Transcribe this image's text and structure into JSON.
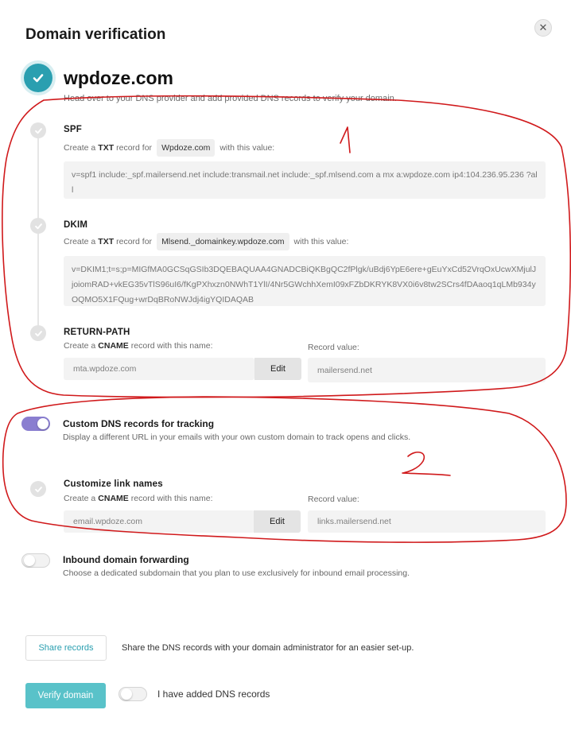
{
  "modal": {
    "title": "Domain verification",
    "close_symbol": "✕"
  },
  "domain": {
    "name": "wpdoze.com",
    "subtitle": "Head over to your DNS provider and add provided DNS records to verify your domain."
  },
  "records": {
    "spf": {
      "title": "SPF",
      "prefix": "Create a",
      "type": "TXT",
      "middle": "record for",
      "host": "Wpdoze.com",
      "suffix": "with this value:",
      "value": "v=spf1 include:_spf.mailersend.net include:transmail.net include:_spf.mlsend.com a mx a:wpdoze.com ip4:104.236.95.236 ?all"
    },
    "dkim": {
      "title": "DKIM",
      "prefix": "Create a",
      "type": "TXT",
      "middle": "record for",
      "host": "Mlsend._domainkey.wpdoze.com",
      "suffix": "with this value:",
      "value": "v=DKIM1;t=s;p=MIGfMA0GCSqGSIb3DQEBAQUAA4GNADCBiQKBgQC2fPlgk/uBdj6YpE6ere+gEuYxCd52VrqOxUcwXMjulJjoiomRAD+vkEG35vTlS96uI6/fKgPXhxzn0NWhT1YlI/4Nr5GWchhXemI09xFZbDKRYK8VX0i6v8tw2SCrs4fDAaoq1qLMb934yOQMO5X1FQug+wrDqBRoNWJdj4igYQIDAQAB"
    },
    "return_path": {
      "title": "RETURN-PATH",
      "prefix": "Create a",
      "type": "CNAME",
      "suffix": "record with this name:",
      "name_value": "mta.wpdoze.com",
      "edit_label": "Edit",
      "record_value_label": "Record value:",
      "record_value": "mailersend.net"
    }
  },
  "tracking": {
    "enabled": true,
    "title": "Custom DNS records for tracking",
    "description": "Display a different URL in your emails with your own custom domain to track opens and clicks.",
    "link_names": {
      "title": "Customize link names",
      "prefix": "Create a",
      "type": "CNAME",
      "suffix": "record with this name:",
      "name_value": "email.wpdoze.com",
      "edit_label": "Edit",
      "record_value_label": "Record value:",
      "record_value": "links.mailersend.net"
    }
  },
  "inbound": {
    "enabled": false,
    "title": "Inbound domain forwarding",
    "description": "Choose a dedicated subdomain that you plan to use exclusively for inbound email processing."
  },
  "footer": {
    "share_label": "Share records",
    "share_description": "Share the DNS records with your domain administrator for an easier set-up.",
    "verify_label": "Verify domain",
    "added_label": "I have added DNS records",
    "added_enabled": false
  },
  "annotations": {
    "label_1": "1",
    "label_2": "2",
    "color": "#d0191b"
  },
  "colors": {
    "accent": "#2a9fb0",
    "toggle_on": "#8a7ed0",
    "verify_button": "#59c2c9"
  }
}
